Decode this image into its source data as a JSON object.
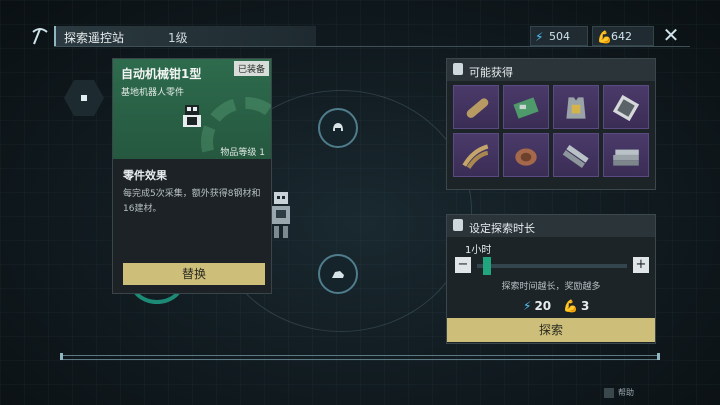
{
  "header": {
    "title": "探索遥控站",
    "level": "1级",
    "energy": "504",
    "material": "642"
  },
  "part": {
    "name": "自动机械钳1型",
    "equipped_badge": "已装备",
    "subtitle": "基地机器人零件",
    "item_level": "物品等级 1",
    "effect_title": "零件效果",
    "effect_desc": "每完成5次采集，额外获得8钢材和16建材。",
    "replace_button": "替换"
  },
  "loot_panel": {
    "title": "可能获得",
    "items": [
      {
        "icon": "wood-log-icon"
      },
      {
        "icon": "circuit-board-icon"
      },
      {
        "icon": "armor-vest-icon"
      },
      {
        "icon": "tablet-device-icon"
      },
      {
        "icon": "steel-pipes-icon"
      },
      {
        "icon": "rope-coil-icon"
      },
      {
        "icon": "metal-bars-icon"
      },
      {
        "icon": "steel-beams-icon"
      }
    ]
  },
  "time_panel": {
    "title": "设定探索时长",
    "duration": "1小时",
    "minus": "−",
    "plus": "+",
    "hint": "探索时间越长，奖励越多",
    "energy_cost": "20",
    "material_cost": "3",
    "explore_button": "探索",
    "slider_fraction": 0.04
  },
  "footer": {
    "help": "帮助"
  }
}
